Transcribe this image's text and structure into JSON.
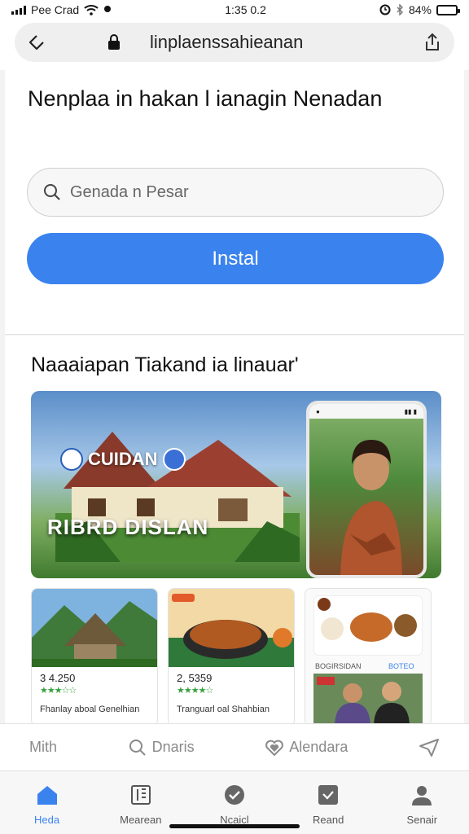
{
  "status": {
    "carrier": "Pee Crad",
    "time": "1:35 0.2",
    "battery": "84%",
    "battery_level": 0.84
  },
  "browser": {
    "url": "linplaenssahieanan"
  },
  "header": {
    "title": "Nenplaa in hakan l ianagin Nenadan"
  },
  "search": {
    "placeholder": "Genada n Pesar"
  },
  "install": {
    "label": "Instal"
  },
  "feature": {
    "section_title": "Naaaiapan Tiakand ia linauar'",
    "hero_badge": "CUIDAN",
    "hero_overlay": "RIBRD DISLAN"
  },
  "tiles": [
    {
      "price": "3 4.250",
      "name": "Fhanlay aboal Genelhian"
    },
    {
      "price": "2, 5359",
      "name": "Tranguarl oal Shahbian"
    }
  ],
  "app_tile": {
    "chip_left": "BOGIRSIDAN",
    "chip_right": "BOTEO"
  },
  "actions": [
    {
      "label": "Mith",
      "icon": "none"
    },
    {
      "label": "Dnaris",
      "icon": "search-icon"
    },
    {
      "label": "Alendara",
      "icon": "heart-icon"
    },
    {
      "label": "",
      "icon": "send-icon"
    }
  ],
  "tabs": [
    {
      "label": "Heda",
      "icon": "home-icon",
      "active": true
    },
    {
      "label": "Mearean",
      "icon": "book-icon",
      "active": false
    },
    {
      "label": "Ncaicl",
      "icon": "check-badge-icon",
      "active": false
    },
    {
      "label": "Reand",
      "icon": "photo-icon",
      "active": false
    },
    {
      "label": "Senair",
      "icon": "profile-icon",
      "active": false
    }
  ],
  "colors": {
    "accent": "#3a83ef",
    "star": "#3aa040"
  }
}
